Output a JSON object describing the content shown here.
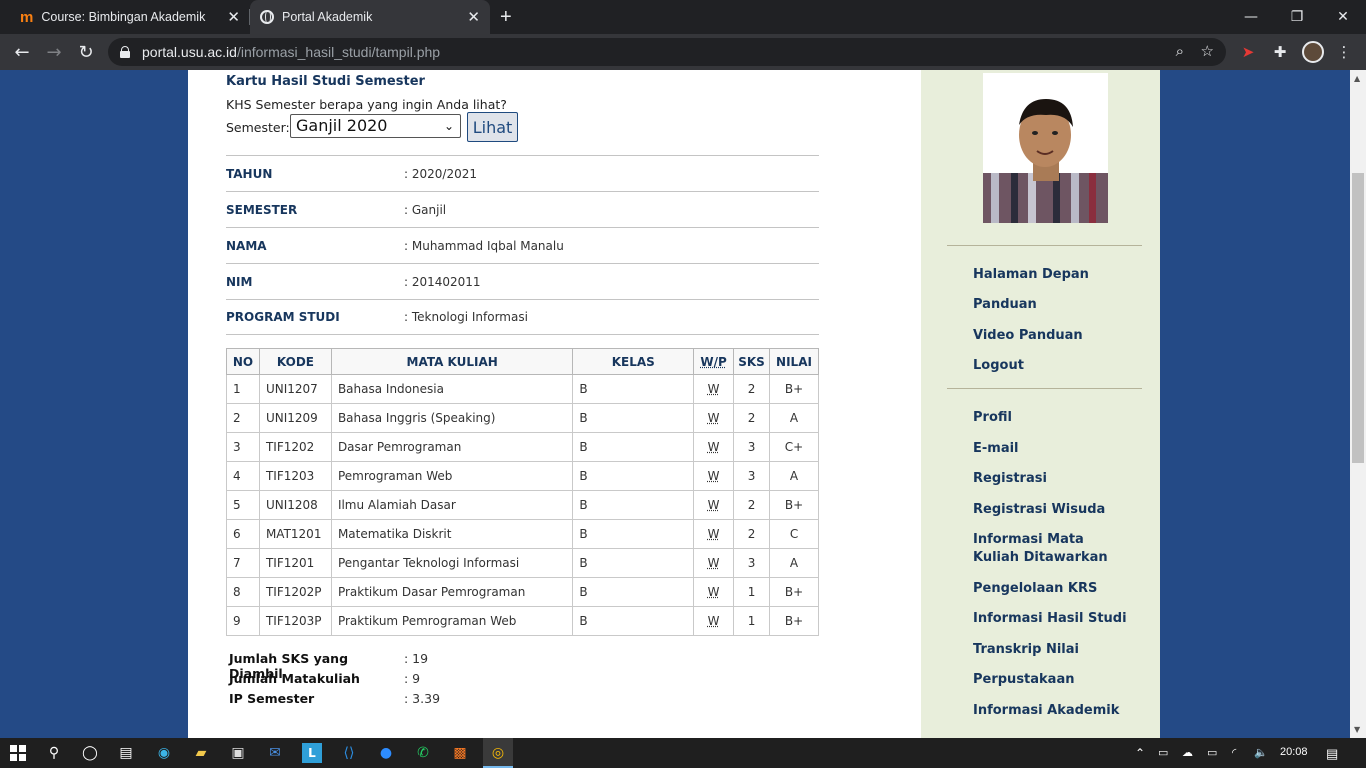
{
  "browser": {
    "tabs": [
      {
        "title": "Course: Bimbingan Akademik",
        "favicon": "moodle-m-icon",
        "active": false
      },
      {
        "title": "Portal Akademik",
        "favicon": "globe-icon",
        "active": true
      }
    ],
    "url_host": "portal.usu.ac.id",
    "url_path": "/informasi_hasil_studi/tampil.php"
  },
  "khs": {
    "title": "Kartu Hasil Studi Semester",
    "prompt": "KHS Semester berapa yang ingin Anda lihat?",
    "semester_label": "Semester:",
    "semester_selected": "Ganjil 2020",
    "view_button": "Lihat"
  },
  "info": [
    {
      "key": "TAHUN",
      "value": ": 2020/2021"
    },
    {
      "key": "SEMESTER",
      "value": ": Ganjil"
    },
    {
      "key": "NAMA",
      "value": ": Muhammad Iqbal Manalu"
    },
    {
      "key": "NIM",
      "value": ": 201402011"
    },
    {
      "key": "PROGRAM STUDI",
      "value": ": Teknologi Informasi"
    }
  ],
  "table": {
    "headers": [
      "NO",
      "KODE",
      "MATA KULIAH",
      "KELAS",
      "W/P",
      "SKS",
      "NILAI"
    ],
    "rows": [
      [
        "1",
        "UNI1207",
        "Bahasa Indonesia",
        "B",
        "W",
        "2",
        "B+"
      ],
      [
        "2",
        "UNI1209",
        "Bahasa Inggris (Speaking)",
        "B",
        "W",
        "2",
        "A"
      ],
      [
        "3",
        "TIF1202",
        "Dasar Pemrograman",
        "B",
        "W",
        "3",
        "C+"
      ],
      [
        "4",
        "TIF1203",
        "Pemrograman Web",
        "B",
        "W",
        "3",
        "A"
      ],
      [
        "5",
        "UNI1208",
        "Ilmu Alamiah Dasar",
        "B",
        "W",
        "2",
        "B+"
      ],
      [
        "6",
        "MAT1201",
        "Matematika Diskrit",
        "B",
        "W",
        "2",
        "C"
      ],
      [
        "7",
        "TIF1201",
        "Pengantar Teknologi Informasi",
        "B",
        "W",
        "3",
        "A"
      ],
      [
        "8",
        "TIF1202P",
        "Praktikum Dasar Pemrograman",
        "B",
        "W",
        "1",
        "B+"
      ],
      [
        "9",
        "TIF1203P",
        "Praktikum Pemrograman Web",
        "B",
        "W",
        "1",
        "B+"
      ]
    ]
  },
  "summary": [
    {
      "key": "Jumlah SKS yang Diambil",
      "value": ": 19"
    },
    {
      "key": "Jumlah Matakuliah",
      "value": ": 9"
    },
    {
      "key": "IP Semester",
      "value": ": 3.39"
    }
  ],
  "sidebar": {
    "group1": [
      "Halaman Depan",
      "Panduan",
      "Video Panduan",
      "Logout"
    ],
    "group2": [
      "Profil",
      "E-mail",
      "Registrasi",
      "Registrasi Wisuda",
      "Informasi Mata Kuliah Ditawarkan",
      "Pengelolaan KRS",
      "Informasi Hasil Studi",
      "Transkrip Nilai",
      "Perpustakaan",
      "Informasi Akademik"
    ]
  },
  "taskbar": {
    "clock": "20:08"
  },
  "colors": {
    "page_background": "#244a86",
    "heading_blue": "#17365d",
    "sidebar_background": "#e8eedb"
  }
}
